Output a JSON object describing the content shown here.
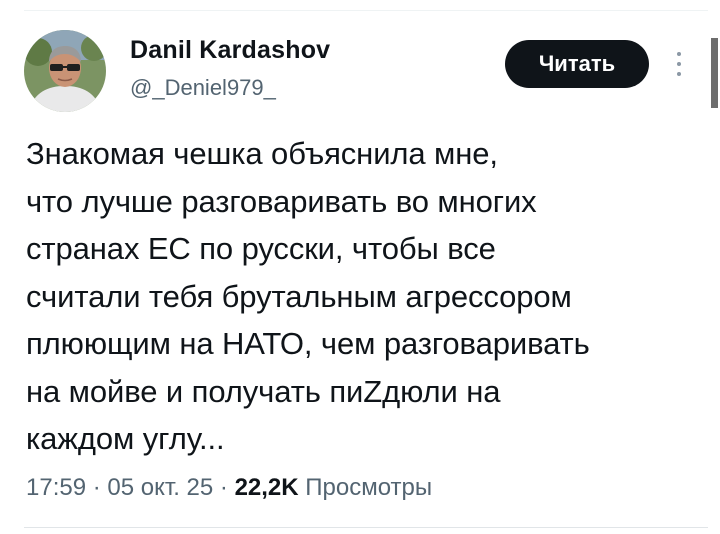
{
  "author": {
    "display_name": "Danil Kardashov",
    "handle": "@_Deniel979_"
  },
  "follow_button": {
    "label": "Читать"
  },
  "more_button": {
    "icon": "vertical-ellipsis-icon"
  },
  "tweet": {
    "text": "Знакомая чешка объяснила мне,\nчто лучше разговаривать во многих\nстранах ЕС по русски, чтобы все\nсчитали тебя брутальным агрессором\nплюющим на НАТО, чем разговаривать\nна мойве и получать пиZдюли на\nкаждом углу..."
  },
  "meta": {
    "time": "17:59",
    "separator": " · ",
    "date": "05 окт. 25",
    "views_count": "22,2K",
    "views_label": "Просмотры"
  },
  "colors": {
    "text": "#0f1419",
    "secondary_text": "#536471",
    "button_bg": "#0f1419",
    "button_text": "#ffffff"
  }
}
